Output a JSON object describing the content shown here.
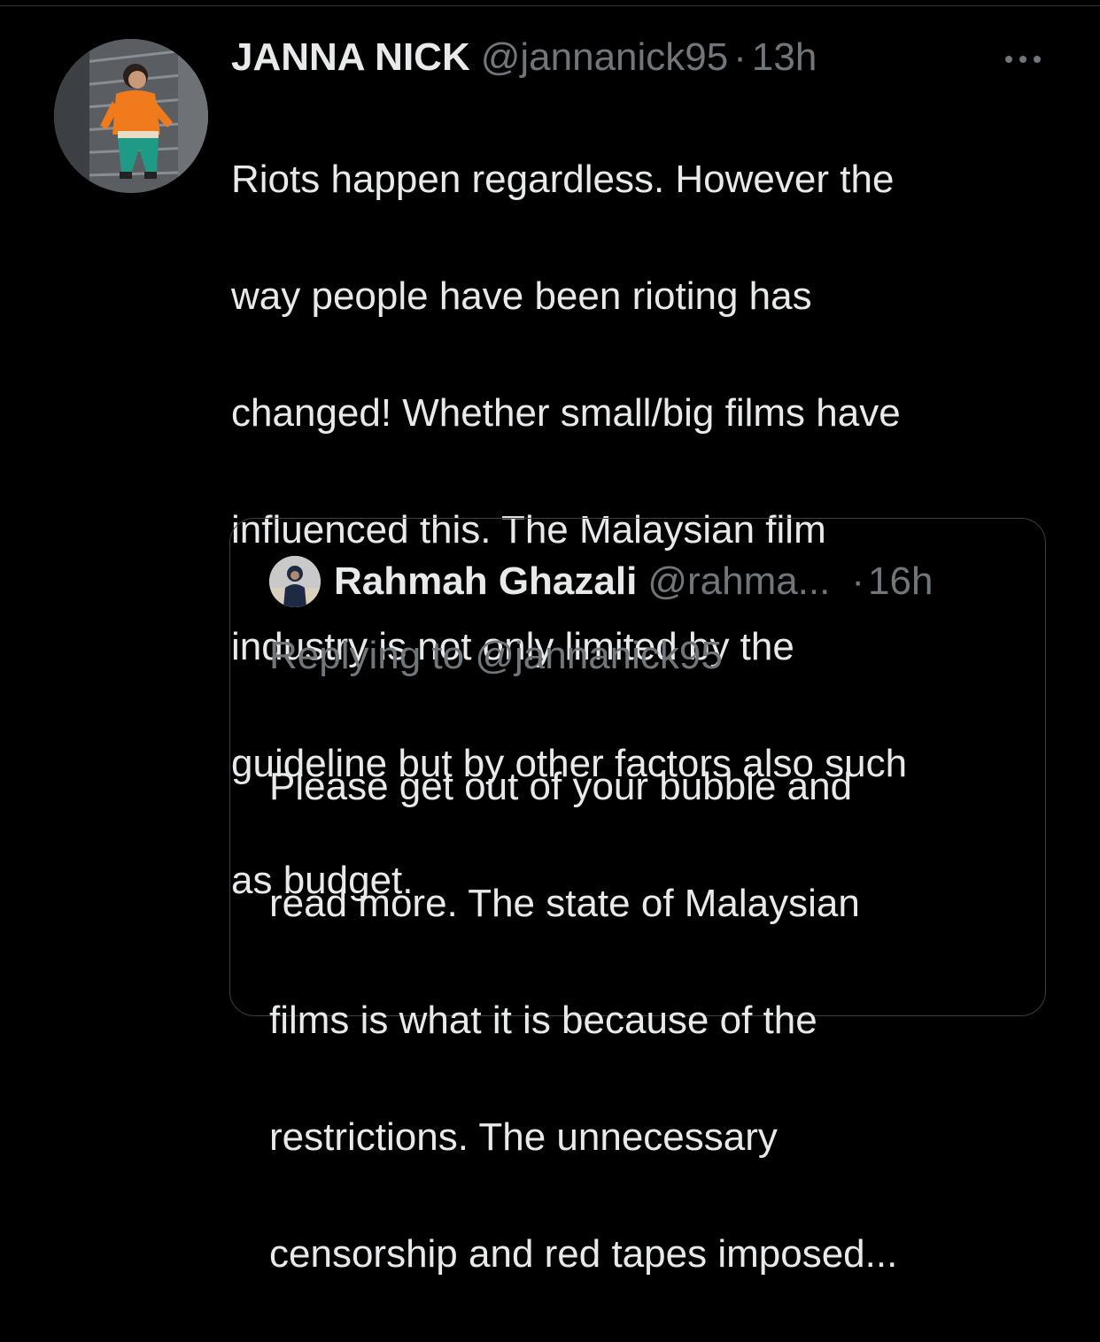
{
  "tweet": {
    "author": {
      "display_name": "JANNA NICK",
      "handle": "@jannanick95"
    },
    "separator": "·",
    "time": "13h",
    "more_icon": "ellipsis-horizontal-icon",
    "text_lines": [
      "Riots happen regardless. However the",
      "way people have been rioting has",
      "changed! Whether small/big films have",
      "influenced this. The Malaysian film",
      "industry is not only limited by the",
      "guideline but by other factors also such",
      "as budget."
    ]
  },
  "quoted_tweet": {
    "author": {
      "display_name": "Rahmah Ghazali",
      "handle": "@rahma..."
    },
    "separator": "·",
    "time": "16h",
    "replying_to": "Replying to @jannanick95",
    "text_lines": [
      "Please get out of your bubble and",
      "read more. The state of Malaysian",
      "films is what it is because of the",
      "restrictions. The unnecessary",
      "censorship and red tapes imposed..."
    ]
  },
  "colors": {
    "background": "#000000",
    "primary_text": "#e7e9ea",
    "secondary_text": "#71767b",
    "border": "#3a3f44"
  }
}
